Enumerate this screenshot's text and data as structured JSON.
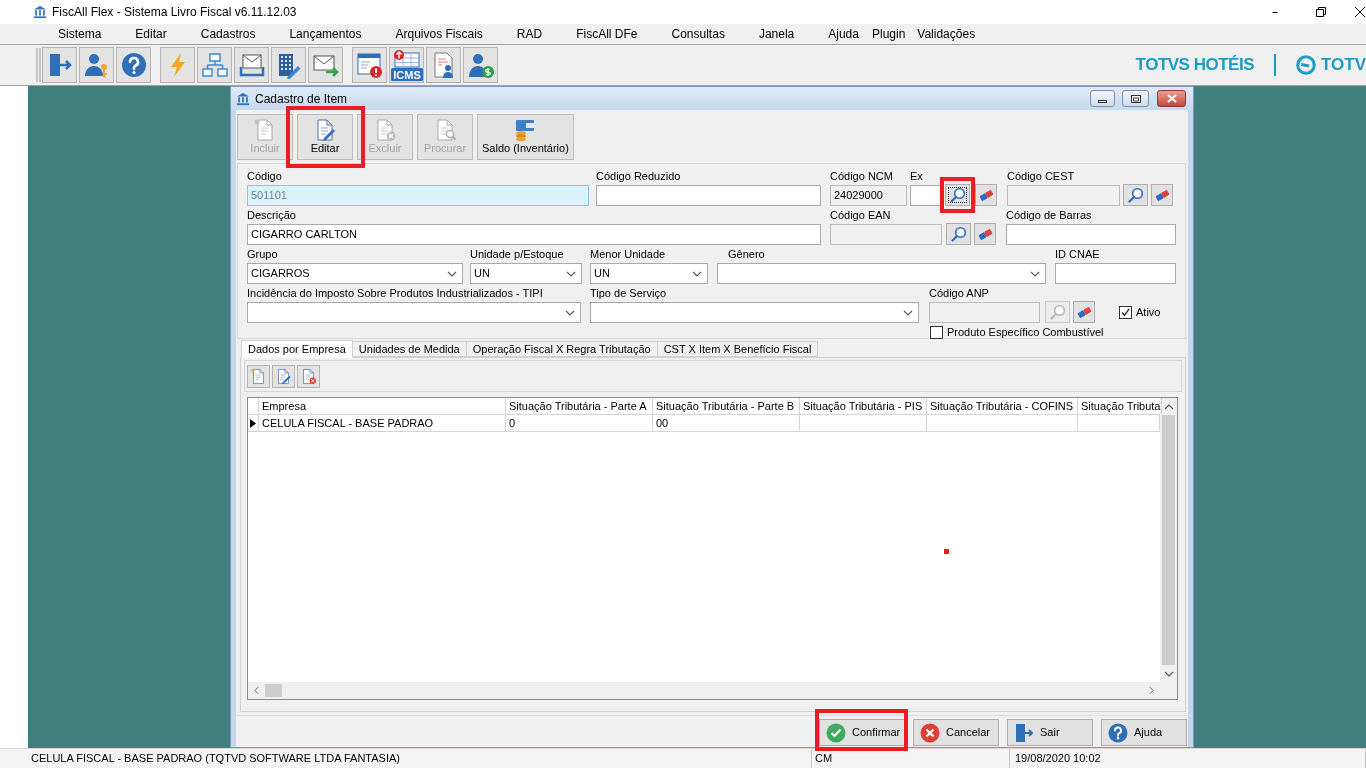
{
  "window": {
    "title": "FiscAll Flex - Sistema Livro Fiscal v6.11.12.03"
  },
  "menu": [
    "Sistema",
    "Editar",
    "Cadastros",
    "Lançamentos",
    "Arquivos Fiscais",
    "RAD",
    "FiscAll DFe",
    "Consultas",
    "Janela",
    "Ajuda",
    "Plugin",
    "Validações"
  ],
  "toolbar": {
    "icon_caption": "ICMS"
  },
  "brand": {
    "name": "TOTVS HOTÉIS",
    "logo_text": "TOTV"
  },
  "dialog": {
    "title": "Cadastro de Item",
    "toolbar": [
      {
        "kind": "new",
        "label": "Incluir",
        "disabled": true,
        "highlighted": false
      },
      {
        "kind": "edit",
        "label": "Editar",
        "disabled": false,
        "highlighted": true
      },
      {
        "kind": "delete",
        "label": "Excluir",
        "disabled": true,
        "highlighted": false
      },
      {
        "kind": "search",
        "label": "Procurar",
        "disabled": true,
        "highlighted": false
      },
      {
        "kind": "balance",
        "label": "Saldo (Inventário)",
        "disabled": false,
        "highlighted": false
      }
    ],
    "form": {
      "codigo": {
        "kind": "text",
        "label": "Código",
        "value": "501101",
        "locked": true,
        "readonly": false
      },
      "codigo_reduzido": {
        "kind": "text",
        "label": "Código Reduzido",
        "locked": false,
        "readonly": false
      },
      "codigo_ncm": {
        "kind": "text",
        "label": "Código NCM",
        "value": "24029000",
        "locked": false,
        "readonly": true
      },
      "ex": {
        "kind": "text",
        "label": "Ex",
        "locked": false,
        "readonly": false,
        "lookup": {
          "disabled": false,
          "focused": true,
          "highlighted": true
        }
      },
      "codigo_cest": {
        "kind": "text",
        "label": "Código CEST",
        "locked": false,
        "readonly": true,
        "lookup": {
          "disabled": false,
          "focused": false
        }
      },
      "descricao": {
        "kind": "text",
        "label": "Descrição",
        "value": "CIGARRO CARLTON",
        "locked": false,
        "readonly": false
      },
      "codigo_ean": {
        "kind": "text",
        "label": "Código EAN",
        "locked": false,
        "readonly": true,
        "lookup": {
          "disabled": false,
          "focused": false
        }
      },
      "codigo_de_barras": {
        "kind": "text",
        "label": "Código de Barras",
        "locked": false,
        "readonly": false
      },
      "grupo": {
        "kind": "dropdown",
        "label": "Grupo",
        "value": "CIGARROS"
      },
      "unidade_estoque": {
        "kind": "dropdown",
        "label": "Unidade p/Estoque",
        "value": "UN"
      },
      "menor_unidade": {
        "kind": "dropdown",
        "label": "Menor Unidade",
        "value": "UN"
      },
      "genero": {
        "kind": "dropdown",
        "label": "Gênero"
      },
      "id_cnae": {
        "kind": "text",
        "label": "ID CNAE",
        "locked": false,
        "readonly": false
      },
      "incidencia_tipi": {
        "kind": "dropdown",
        "label": "Incidência do Imposto Sobre Produtos Industrializados - TIPI"
      },
      "tipo_servico": {
        "kind": "dropdown",
        "label": "Tipo de Serviço"
      },
      "codigo_anp": {
        "kind": "text",
        "label": "Código ANP",
        "locked": false,
        "readonly": true,
        "lookup": {
          "disabled": true,
          "focused": false
        }
      },
      "ativo": {
        "kind": "checkbox",
        "label": "Ativo",
        "checked": true
      },
      "produto_combustivel": {
        "kind": "checkbox",
        "label": "Produto Específico Combustível",
        "checked": false
      }
    },
    "tabs": [
      {
        "label": "Dados por Empresa",
        "selected": true
      },
      {
        "label": "Unidades de Medida",
        "selected": false
      },
      {
        "label": "Operação Fiscal X Regra Tributação",
        "selected": false
      },
      {
        "label": "CST X Item X Benefício Fiscal",
        "selected": false
      }
    ],
    "grid": {
      "columns": [
        "Empresa",
        "Situação Tributária - Parte A",
        "Situação Tributária - Parte B",
        "Situação Tributária - PIS",
        "Situação Tributária - COFINS",
        "Situação Tributa"
      ],
      "rows": [
        {
          "current": true,
          "cells": [
            "CELULA FISCAL - BASE PADRAO",
            "0",
            "00",
            null,
            null,
            null
          ]
        }
      ]
    },
    "buttons": [
      {
        "kind": "confirm",
        "label": "Confirmar",
        "highlighted": true
      },
      {
        "kind": "cancel",
        "label": "Cancelar",
        "highlighted": false
      },
      {
        "kind": "exit",
        "label": "Sair",
        "highlighted": false
      },
      {
        "kind": "help",
        "label": "Ajuda",
        "highlighted": false
      }
    ]
  },
  "status_bar": [
    "CELULA FISCAL - BASE PADRAO (TQTVD SOFTWARE LTDA FANTASIA)",
    "CM",
    "19/08/2020 10:02"
  ]
}
